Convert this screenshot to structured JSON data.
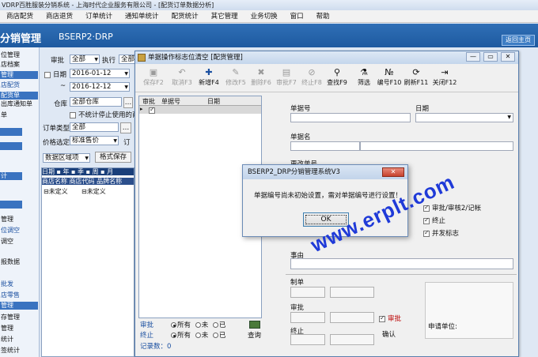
{
  "app": {
    "title": "VDRP百胜服装分销系统 - 上海时代企业服务有限公司 - [配货订单数据分析]",
    "menu": [
      "商店配货",
      "商店退货",
      "订单统计",
      "通知单统计",
      "配货统计",
      "其它管理",
      "业务切换",
      "窗口",
      "帮助"
    ],
    "banner_title": "分销管理",
    "banner_subtitle": "BSERP2·DRP",
    "return_label": "返回主页"
  },
  "sidebar": {
    "items": [
      "位管理",
      "店档案",
      "管理",
      "店配货",
      "配货单",
      "商店配货",
      "出库通知单",
      "单",
      "",
      "",
      "",
      "计",
      "",
      "",
      "",
      "",
      "",
      "管理",
      "位调空",
      "调空",
      "",
      "报数据",
      "",
      "批发",
      "店零售",
      "管理",
      "存管理",
      "管理",
      "统计",
      "签统计",
      "统计"
    ]
  },
  "bgform": {
    "audit_label": "审批",
    "audit_value": "全部",
    "exec_label": "执行",
    "exec_value": "全部",
    "date_label": "日期",
    "date_from": "2016-01-12",
    "date_to": "2016-12-12",
    "warehouse_label": "仓库",
    "warehouse_value": "全部仓库",
    "check_text": "不统计停止使用的商",
    "ordertype_label": "订单类型",
    "ordertype_value": "全部",
    "price_label": "价格选定",
    "price_value": "标准售价",
    "price_suffix": "订",
    "datasource_value": "数据区域项",
    "format_save": "格式保存",
    "grid_cols": [
      "日期",
      "年",
      "季",
      "周",
      "月"
    ],
    "grid_cols2": [
      "商店名称",
      "商店代码",
      "品牌名称"
    ],
    "row1": "未定义",
    "row2": "未定义"
  },
  "win": {
    "title": "单据操作标志位清空 [配货管理]",
    "toolbar": [
      {
        "label": "保存F2",
        "icon": "save-icon",
        "glyph": "▣",
        "enabled": false
      },
      {
        "label": "取消F3",
        "icon": "undo-icon",
        "glyph": "↶",
        "enabled": false
      },
      {
        "label": "新增F4",
        "icon": "plus-icon",
        "glyph": "✚",
        "enabled": true
      },
      {
        "label": "修改F5",
        "icon": "edit-icon",
        "glyph": "✎",
        "enabled": false
      },
      {
        "label": "删除F6",
        "icon": "delete-icon",
        "glyph": "✖",
        "enabled": false
      },
      {
        "label": "审批F7",
        "icon": "approve-icon",
        "glyph": "▤",
        "enabled": false
      },
      {
        "label": "终止F8",
        "icon": "stop-icon",
        "glyph": "⊘",
        "enabled": false
      },
      {
        "label": "查找F9",
        "icon": "find-icon",
        "glyph": "⚲",
        "enabled": true
      },
      {
        "label": "筛选",
        "icon": "filter-icon",
        "glyph": "⚗",
        "enabled": true
      },
      {
        "label": "编号F10",
        "icon": "number-icon",
        "glyph": "№",
        "enabled": true
      },
      {
        "label": "刷新F11",
        "icon": "refresh-icon",
        "glyph": "⟳",
        "enabled": true
      },
      {
        "label": "关闭F12",
        "icon": "close-door-icon",
        "glyph": "⇥",
        "enabled": true
      }
    ],
    "list_cols": [
      "审批",
      "单据号",
      "日期"
    ],
    "detail": {
      "docno_label": "单据号",
      "date_label": "日期",
      "docname_label": "单据名",
      "change_label": "更改单号",
      "chk_audit": "审批/审核2/记帐",
      "chk_stop": "终止",
      "chk_sent": "并发标志",
      "reason_label": "事由",
      "creator_label": "制单",
      "auditor_label": "审批",
      "stopper_label": "终止",
      "apply_unit_label": "申请单位:",
      "audit_check_label": "审批",
      "confirm_label": "确认"
    },
    "filter": {
      "audit_label": "审批",
      "stop_label": "终止",
      "opt_all": "所有",
      "opt_not": "未",
      "opt_done": "已",
      "query_label": "查询",
      "count_label": "记录数：",
      "count_value": "0"
    }
  },
  "dialog": {
    "title": "BSERP2_DRP分销管理系统V3",
    "message": "单据编号尚未初始设置，需对单据编号进行设置！",
    "ok_label": "OK",
    "close_label": "✕"
  },
  "watermark": "www.erplt.com",
  "colors": {
    "banner": "#1e5aa0",
    "accent": "#3a73c0",
    "watermark": "#1f3ad8"
  }
}
